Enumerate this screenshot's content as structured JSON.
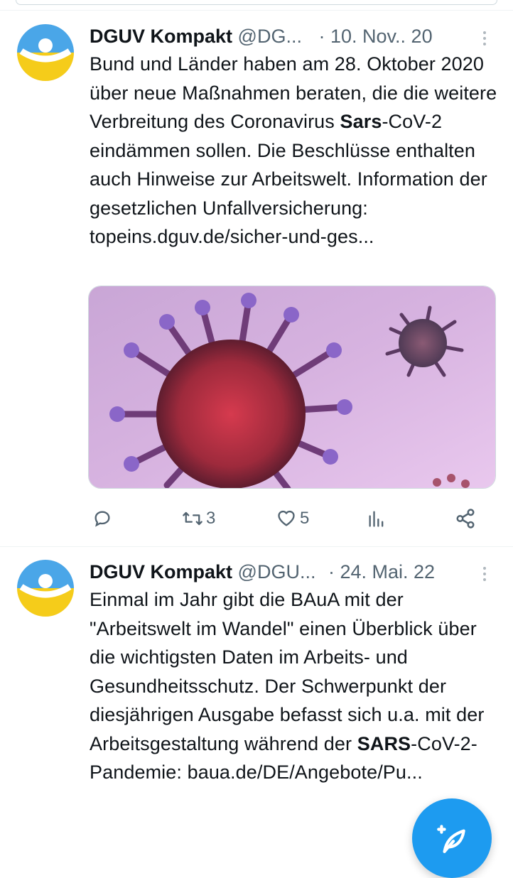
{
  "tweets": [
    {
      "display_name": "DGUV Kompakt",
      "handle": "@DG...",
      "separator": "·",
      "date": "10. Nov.. 20",
      "text_parts": [
        "Bund und Länder haben am 28. Oktober 2020 über neue Maßnahmen beraten, die die weitere Verbreitung des Coronavirus ",
        "Sars",
        "-CoV-2 eindämmen sollen. Die Beschlüsse enthalten auch Hinweise zur Arbeitswelt. Information der gesetzlichen Unfallversicherung: topeins.dguv.de/sicher-und-ges..."
      ],
      "media": "coronavirus-illustration",
      "actions": {
        "reply_count": "",
        "retweet_count": "3",
        "like_count": "5"
      }
    },
    {
      "display_name": "DGUV Kompakt",
      "handle": "@DGU...",
      "separator": "·",
      "date": "24. Mai. 22",
      "text_parts": [
        "Einmal im Jahr gibt die BAuA mit der \"Arbeitswelt im Wandel\" einen Überblick über die wichtigsten Daten im Arbeits- und Gesundheitsschutz. Der Schwerpunkt der diesjährigen Ausgabe befasst sich u.a. mit der Arbeitsgestaltung während der ",
        "SARS",
        "-CoV-2-Pandemie: baua.de/DE/Angebote/Pu..."
      ]
    }
  ],
  "colors": {
    "accent": "#1d9bf0",
    "text": "#0f1419",
    "muted": "#536471",
    "avatar_blue": "#4aa6e8",
    "avatar_yellow": "#f5cc1a"
  },
  "icons": [
    "more-icon",
    "reply-icon",
    "retweet-icon",
    "like-icon",
    "views-icon",
    "share-icon",
    "compose-icon"
  ]
}
